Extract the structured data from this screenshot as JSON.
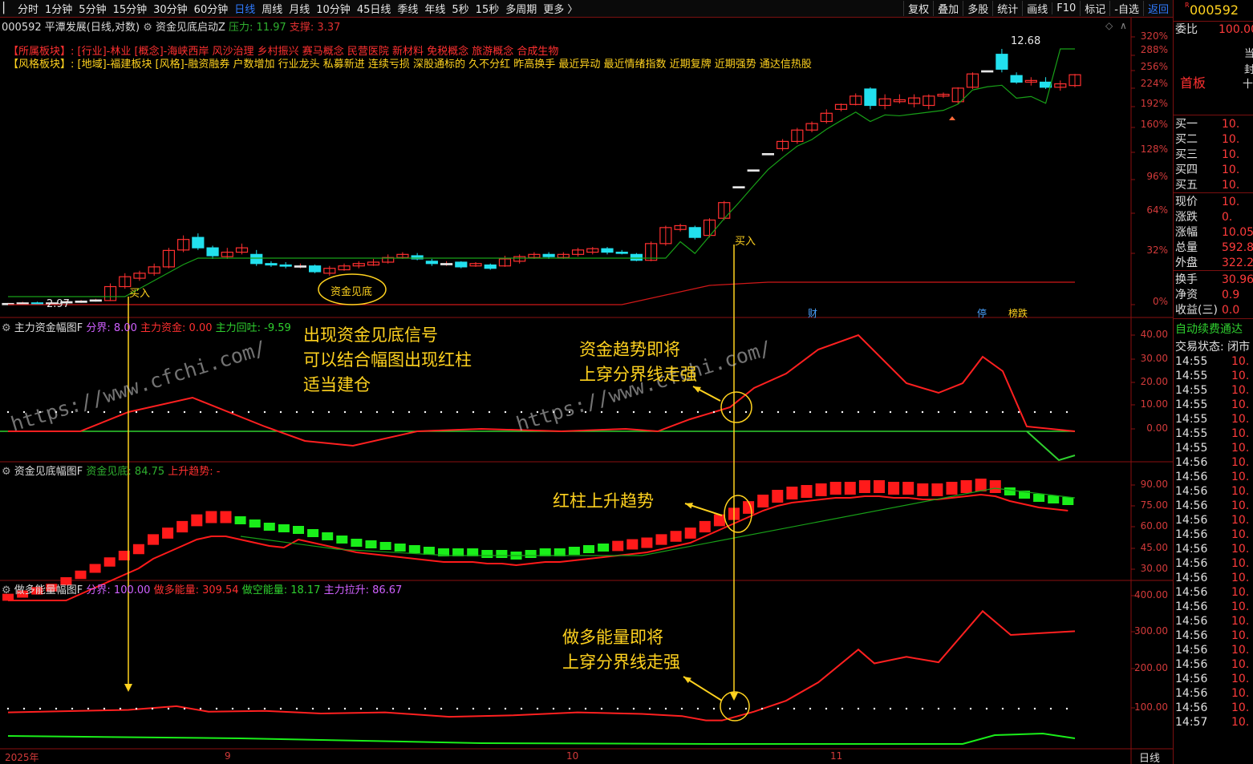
{
  "toolbar": {
    "tabs": [
      {
        "label": "分时"
      },
      {
        "label": "1分钟"
      },
      {
        "label": "5分钟"
      },
      {
        "label": "15分钟"
      },
      {
        "label": "30分钟"
      },
      {
        "label": "60分钟"
      },
      {
        "label": "日线",
        "active": true
      },
      {
        "label": "周线"
      },
      {
        "label": "月线"
      },
      {
        "label": "10分钟"
      },
      {
        "label": "45日线"
      },
      {
        "label": "季线"
      },
      {
        "label": "年线"
      },
      {
        "label": "5秒"
      },
      {
        "label": "15秒"
      },
      {
        "label": "多周期"
      },
      {
        "label": "更多 〉"
      }
    ],
    "right_buttons": [
      "复权",
      "叠加",
      "多股",
      "统计",
      "画线",
      "F10",
      "标记",
      "-自选",
      "返回"
    ]
  },
  "main_header": {
    "stock": "000592 平潭发展(日线,对数)",
    "indicator": "资金见底启动Z",
    "pressure_label": "压力: 11.97",
    "support_label": "支撑: 3.37"
  },
  "sector": {
    "label": "【所属板块】:",
    "text": "[行业]-林业 [概念]-海峡西岸 风沙治理 乡村振兴 赛马概念 民营医院 新材料 免税概念 旅游概念 合成生物"
  },
  "style": {
    "label": "【风格板块】:",
    "text": "[地域]-福建板块 [风格]-融资融券 户数增加 行业龙头 私募新进 连续亏损 深股通标的 久不分红 昨高换手 最近异动 最近情绪指数 近期复牌 近期强势 通达信热股"
  },
  "price_axis": [
    "320%",
    "288%",
    "256%",
    "224%",
    "192%",
    "160%",
    "128%",
    "96%",
    "64%",
    "32%",
    "0%"
  ],
  "price_marks": {
    "high": "12.68",
    "low": "2.97",
    "buy": "买入",
    "bottom": "资金见底",
    "tags": [
      "财",
      "停",
      "榜跌"
    ]
  },
  "panel1": {
    "title": "主力资金幅图F",
    "f1": "分界: 8.00",
    "f2": "主力资金: 0.00",
    "f3": "主力回吐: -9.59",
    "axis": [
      "40.00",
      "30.00",
      "20.00",
      "10.00",
      "0.00"
    ]
  },
  "panel2": {
    "title": "资金见底幅图F",
    "f1": "资金见底: 84.75",
    "f2": "上升趋势: -",
    "axis": [
      "90.00",
      "75.00",
      "60.00",
      "45.00",
      "30.00"
    ]
  },
  "panel3": {
    "title": "做多能量幅图F",
    "f1": "分界: 100.00",
    "f2": "做多能量: 309.54",
    "f3": "做空能量: 18.17",
    "f4": "主力拉升: 86.67",
    "axis": [
      "400.00",
      "300.00",
      "200.00",
      "100.00"
    ]
  },
  "x_axis": {
    "labels": [
      "2025年",
      "9",
      "10",
      "11"
    ],
    "period": "日线"
  },
  "annotations": {
    "a1": [
      "出现资金见底信号",
      "可以结合幅图出现红柱",
      "适当建仓"
    ],
    "a2": [
      "资金趋势即将",
      "上穿分界线走强"
    ],
    "a3": [
      "红柱上升趋势"
    ],
    "a4": [
      "做多能量即将",
      "上穿分界线走强"
    ]
  },
  "watermark": "https://www.cfchi.com/",
  "right_panel": {
    "code": "000592",
    "weibi_label": "委比",
    "weibi_value": "100.00",
    "first_board": "首板",
    "side_text": [
      "当",
      "封",
      "十"
    ],
    "bids": [
      {
        "label": "买一",
        "value": "10."
      },
      {
        "label": "买二",
        "value": "10."
      },
      {
        "label": "买三",
        "value": "10."
      },
      {
        "label": "买四",
        "value": "10."
      },
      {
        "label": "买五",
        "value": "10."
      }
    ],
    "stats": [
      {
        "label": "现价",
        "value": "10."
      },
      {
        "label": "涨跌",
        "value": "0."
      },
      {
        "label": "涨幅",
        "value": "10.05"
      },
      {
        "label": "总量",
        "value": "592.8"
      },
      {
        "label": "外盘",
        "value": "322.2"
      }
    ],
    "stats2": [
      {
        "label": "换手",
        "value": "30.96"
      },
      {
        "label": "净资",
        "value": "0.9"
      },
      {
        "label": "收益(三)",
        "value": "0.0"
      }
    ],
    "auto_fee": "自动续费通达",
    "trade_status": "交易状态: 闭市",
    "ticks": [
      {
        "t": "14:55",
        "p": "10."
      },
      {
        "t": "14:55",
        "p": "10."
      },
      {
        "t": "14:55",
        "p": "10."
      },
      {
        "t": "14:55",
        "p": "10."
      },
      {
        "t": "14:55",
        "p": "10."
      },
      {
        "t": "14:55",
        "p": "10."
      },
      {
        "t": "14:55",
        "p": "10."
      },
      {
        "t": "14:56",
        "p": "10."
      },
      {
        "t": "14:56",
        "p": "10."
      },
      {
        "t": "14:56",
        "p": "10."
      },
      {
        "t": "14:56",
        "p": "10."
      },
      {
        "t": "14:56",
        "p": "10."
      },
      {
        "t": "14:56",
        "p": "10."
      },
      {
        "t": "14:56",
        "p": "10."
      },
      {
        "t": "14:56",
        "p": "10."
      },
      {
        "t": "14:56",
        "p": "10."
      },
      {
        "t": "14:56",
        "p": "10."
      },
      {
        "t": "14:56",
        "p": "10."
      },
      {
        "t": "14:56",
        "p": "10."
      },
      {
        "t": "14:56",
        "p": "10."
      },
      {
        "t": "14:56",
        "p": "10."
      },
      {
        "t": "14:56",
        "p": "10."
      },
      {
        "t": "14:56",
        "p": "10."
      },
      {
        "t": "14:56",
        "p": "10."
      },
      {
        "t": "14:56",
        "p": "10."
      },
      {
        "t": "14:57",
        "p": "10."
      }
    ]
  },
  "chart_data": {
    "type": "candlestick",
    "price_range": [
      2.97,
      12.68
    ],
    "candles": [
      {
        "o": 2.98,
        "c": 2.99,
        "h": 3.0,
        "l": 2.97
      },
      {
        "o": 2.99,
        "c": 3.0,
        "h": 3.02,
        "l": 2.98
      },
      {
        "o": 3.0,
        "c": 2.98,
        "h": 3.02,
        "l": 2.97
      },
      {
        "o": 2.98,
        "c": 3.0,
        "h": 3.02,
        "l": 2.97
      },
      {
        "o": 3.0,
        "c": 3.02,
        "h": 3.04,
        "l": 2.99
      },
      {
        "o": 3.02,
        "c": 3.03,
        "h": 3.05,
        "l": 3.0
      },
      {
        "o": 3.03,
        "c": 3.05,
        "h": 3.07,
        "l": 3.02
      },
      {
        "o": 3.04,
        "c": 3.29,
        "h": 3.35,
        "l": 3.03
      },
      {
        "o": 3.29,
        "c": 3.48,
        "h": 3.55,
        "l": 3.25
      },
      {
        "o": 3.45,
        "c": 3.55,
        "h": 3.6,
        "l": 3.4
      },
      {
        "o": 3.55,
        "c": 3.68,
        "h": 3.75,
        "l": 3.5
      },
      {
        "o": 3.68,
        "c": 4.04,
        "h": 4.1,
        "l": 3.65
      },
      {
        "o": 4.05,
        "c": 4.3,
        "h": 4.4,
        "l": 4.0
      },
      {
        "o": 4.35,
        "c": 4.1,
        "h": 4.45,
        "l": 4.05
      },
      {
        "o": 4.1,
        "c": 3.92,
        "h": 4.15,
        "l": 3.85
      },
      {
        "o": 3.9,
        "c": 4.0,
        "h": 4.1,
        "l": 3.85
      },
      {
        "o": 4.0,
        "c": 4.1,
        "h": 4.2,
        "l": 3.95
      },
      {
        "o": 3.95,
        "c": 3.75,
        "h": 4.05,
        "l": 3.7
      },
      {
        "o": 3.75,
        "c": 3.72,
        "h": 3.8,
        "l": 3.68
      },
      {
        "o": 3.72,
        "c": 3.7,
        "h": 3.78,
        "l": 3.65
      },
      {
        "o": 3.7,
        "c": 3.7,
        "h": 3.75,
        "l": 3.65
      },
      {
        "o": 3.7,
        "c": 3.58,
        "h": 3.73,
        "l": 3.55
      },
      {
        "o": 3.55,
        "c": 3.65,
        "h": 3.7,
        "l": 3.5
      },
      {
        "o": 3.62,
        "c": 3.7,
        "h": 3.75,
        "l": 3.6
      },
      {
        "o": 3.7,
        "c": 3.75,
        "h": 3.8,
        "l": 3.65
      },
      {
        "o": 3.72,
        "c": 3.78,
        "h": 3.85,
        "l": 3.7
      },
      {
        "o": 3.78,
        "c": 3.88,
        "h": 3.95,
        "l": 3.75
      },
      {
        "o": 3.88,
        "c": 3.95,
        "h": 4.0,
        "l": 3.85
      },
      {
        "o": 3.92,
        "c": 3.85,
        "h": 3.98,
        "l": 3.82
      },
      {
        "o": 3.8,
        "c": 3.75,
        "h": 3.85,
        "l": 3.7
      },
      {
        "o": 3.75,
        "c": 3.75,
        "h": 3.8,
        "l": 3.7
      },
      {
        "o": 3.78,
        "c": 3.68,
        "h": 3.8,
        "l": 3.65
      },
      {
        "o": 3.7,
        "c": 3.75,
        "h": 3.78,
        "l": 3.68
      },
      {
        "o": 3.72,
        "c": 3.65,
        "h": 3.75,
        "l": 3.62
      },
      {
        "o": 3.7,
        "c": 3.85,
        "h": 3.92,
        "l": 3.68
      },
      {
        "o": 3.8,
        "c": 3.9,
        "h": 3.95,
        "l": 3.75
      },
      {
        "o": 3.88,
        "c": 3.95,
        "h": 4.0,
        "l": 3.85
      },
      {
        "o": 3.95,
        "c": 3.9,
        "h": 4.0,
        "l": 3.85
      },
      {
        "o": 3.88,
        "c": 3.95,
        "h": 4.0,
        "l": 3.85
      },
      {
        "o": 3.95,
        "c": 4.05,
        "h": 4.1,
        "l": 3.9
      },
      {
        "o": 4.0,
        "c": 4.08,
        "h": 4.12,
        "l": 3.95
      },
      {
        "o": 4.08,
        "c": 4.0,
        "h": 4.12,
        "l": 3.95
      },
      {
        "o": 4.0,
        "c": 3.98,
        "h": 4.05,
        "l": 3.95
      },
      {
        "o": 3.95,
        "c": 3.82,
        "h": 3.98,
        "l": 3.8
      },
      {
        "o": 3.82,
        "c": 4.2,
        "h": 4.25,
        "l": 3.8
      },
      {
        "o": 4.2,
        "c": 4.6,
        "h": 4.65,
        "l": 4.15
      },
      {
        "o": 4.55,
        "c": 4.65,
        "h": 4.7,
        "l": 4.5
      },
      {
        "o": 4.6,
        "c": 4.35,
        "h": 4.65,
        "l": 4.3
      },
      {
        "o": 4.4,
        "c": 4.8,
        "h": 4.85,
        "l": 4.35
      },
      {
        "o": 4.85,
        "c": 5.3,
        "h": 5.35,
        "l": 4.8
      },
      {
        "o": 5.8,
        "c": 5.8,
        "h": 5.8,
        "l": 5.8
      },
      {
        "o": 6.38,
        "c": 6.38,
        "h": 6.38,
        "l": 6.38
      },
      {
        "o": 7.0,
        "c": 7.0,
        "h": 7.0,
        "l": 7.0
      },
      {
        "o": 7.2,
        "c": 7.5,
        "h": 7.6,
        "l": 7.1
      },
      {
        "o": 7.5,
        "c": 8.0,
        "h": 8.1,
        "l": 7.4
      },
      {
        "o": 8.0,
        "c": 8.3,
        "h": 8.4,
        "l": 7.9
      },
      {
        "o": 8.4,
        "c": 8.8,
        "h": 9.0,
        "l": 8.3
      },
      {
        "o": 9.0,
        "c": 9.25,
        "h": 9.3,
        "l": 8.9
      },
      {
        "o": 9.25,
        "c": 9.7,
        "h": 9.85,
        "l": 9.2
      },
      {
        "o": 10.1,
        "c": 9.2,
        "h": 10.2,
        "l": 9.0
      },
      {
        "o": 9.2,
        "c": 9.55,
        "h": 9.8,
        "l": 9.0
      },
      {
        "o": 9.4,
        "c": 9.5,
        "h": 9.8,
        "l": 9.3
      },
      {
        "o": 9.3,
        "c": 9.6,
        "h": 9.8,
        "l": 9.1
      },
      {
        "o": 9.2,
        "c": 9.7,
        "h": 9.8,
        "l": 9.0
      },
      {
        "o": 9.7,
        "c": 9.8,
        "h": 9.9,
        "l": 9.6
      },
      {
        "o": 9.4,
        "c": 10.15,
        "h": 10.2,
        "l": 9.3
      },
      {
        "o": 10.2,
        "c": 11.0,
        "h": 11.1,
        "l": 10.1
      },
      {
        "o": 11.2,
        "c": 11.2,
        "h": 11.2,
        "l": 11.2
      },
      {
        "o": 12.3,
        "c": 11.3,
        "h": 12.68,
        "l": 11.1
      },
      {
        "o": 10.9,
        "c": 10.5,
        "h": 11.1,
        "l": 10.4
      },
      {
        "o": 10.5,
        "c": 10.6,
        "h": 10.8,
        "l": 10.3
      },
      {
        "o": 10.5,
        "c": 10.2,
        "h": 10.8,
        "l": 10.1
      },
      {
        "o": 10.2,
        "c": 10.4,
        "h": 10.6,
        "l": 10.0
      },
      {
        "o": 10.3,
        "c": 10.95,
        "h": 11.0,
        "l": 10.2
      }
    ]
  }
}
